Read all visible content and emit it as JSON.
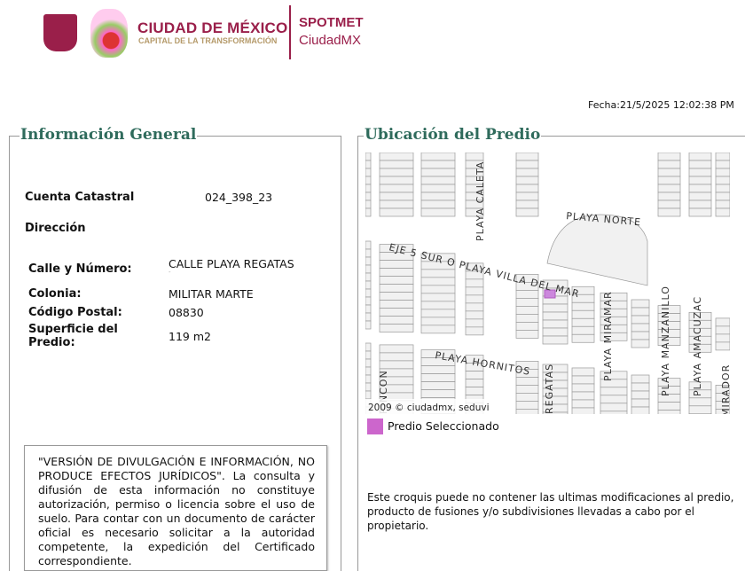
{
  "header": {
    "brand_title": "CIUDAD DE MÉXICO",
    "brand_subtitle": "CAPITAL DE LA TRANSFORMACIÓN",
    "app_name": "SPOTMET",
    "app_subname": "CiudadMX",
    "date": "Fecha:21/5/2025 12:02:38 PM"
  },
  "info": {
    "title": "Información General",
    "cuenta_label": "Cuenta Catastral",
    "cuenta_value": "024_398_23",
    "direccion_label": "Dirección",
    "calle_label": "Calle y Número:",
    "calle_value": "CALLE PLAYA REGATAS",
    "calle_extra": "-",
    "colonia_label": "Colonia:",
    "colonia_value": "MILITAR MARTE",
    "cp_label": "Código Postal:",
    "cp_value": "08830",
    "superficie_label": "Superficie del Predio:",
    "superficie_value": "119 m2",
    "disclaimer": "\"VERSIÓN DE DIVULGACIÓN E INFORMACIÓN, NO PRODUCE EFECTOS JURÍDICOS\". La consulta y difusión de esta información no constituye autorización, permiso o licencia sobre el uso de suelo. Para contar con un documento de carácter oficial es necesario solicitar a la autoridad competente, la expedición del Certificado correspondiente."
  },
  "location": {
    "title": "Ubicación del Predio",
    "streets": [
      "PLAYA CALETA",
      "PLAYA NORTE",
      "EJE 5 SUR O PLAYA VILLA DEL MAR",
      "PLAYA MIRAMAR",
      "PLAYA MANZANILLO",
      "PLAYA AMACUZAC",
      "PLAYA HORNITOS",
      "RINCON",
      "REGATAS",
      "MIRADOR"
    ],
    "copyright": "2009 © ciudadmx, seduvi",
    "legend_label": "Predio Seleccionado",
    "legend_color": "#cc66cc",
    "note": "Este croquis puede no contener las ultimas modificaciones al predio, producto de fusiones y/o subdivisiones llevadas a cabo por el propietario."
  }
}
